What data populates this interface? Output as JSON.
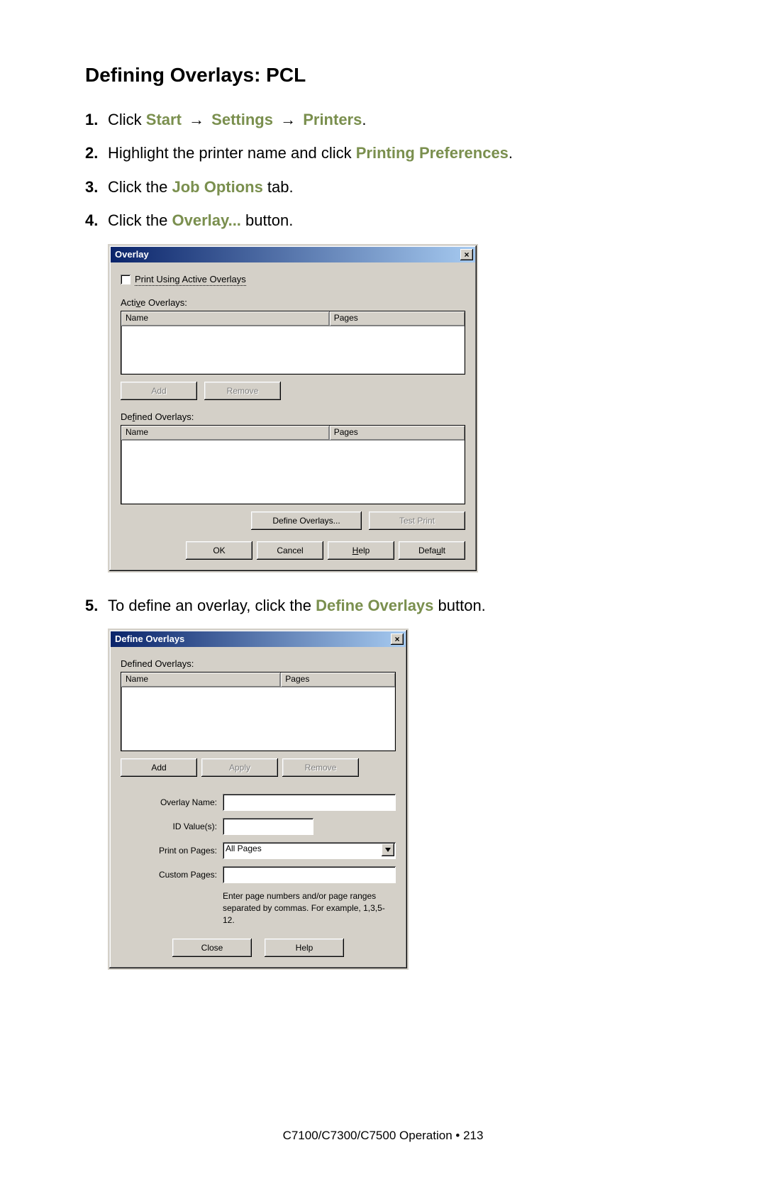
{
  "heading": "Defining Overlays: PCL",
  "steps": {
    "s1": {
      "num": "1.",
      "prefix": "Click ",
      "kw1": "Start",
      "kw2": "Settings",
      "kw3": "Printers",
      "suffix": "."
    },
    "s2": {
      "num": "2.",
      "prefix": "Highlight the printer name and click ",
      "kw": "Printing Preferences",
      "suffix": "."
    },
    "s3": {
      "num": "3.",
      "prefix": "Click the ",
      "kw": "Job Options",
      "suffix": " tab."
    },
    "s4": {
      "num": "4.",
      "prefix": "Click the ",
      "kw": "Overlay...",
      "suffix": " button."
    },
    "s5": {
      "num": "5.",
      "prefix": "To define an overlay, click the ",
      "kw": "Define Overlays",
      "suffix": " button."
    }
  },
  "dlg1": {
    "title": "Overlay",
    "close": "×",
    "print_using": "Print Using Active Overlays",
    "active_label_pre": "Acti",
    "active_label_ul": "v",
    "active_label_post": "e Overlays:",
    "col_name": "Name",
    "col_pages": "Pages",
    "btn_add": "Add",
    "btn_remove": "Remove",
    "defined_label_pre": "De",
    "defined_label_ul": "f",
    "defined_label_post": "ined Overlays:",
    "btn_define": "Define Overlays...",
    "btn_test": "Test Print",
    "btn_ok": "OK",
    "btn_cancel": "Cancel",
    "btn_help_pre": "",
    "btn_help_ul": "H",
    "btn_help_post": "elp",
    "btn_default_pre": "Defa",
    "btn_default_ul": "u",
    "btn_default_post": "lt"
  },
  "dlg2": {
    "title": "Define Overlays",
    "close": "×",
    "defined_label": "Defined Overlays:",
    "col_name": "Name",
    "col_pages": "Pages",
    "btn_add": "Add",
    "btn_apply": "Apply",
    "btn_remove": "Remove",
    "overlay_name": "Overlay Name:",
    "id_values": "ID Value(s):",
    "print_on_pages": "Print on Pages:",
    "print_on_pages_value": "All Pages",
    "custom_pages": "Custom Pages:",
    "hint": "Enter page numbers and/or page ranges separated by commas. For example, 1,3,5-12.",
    "btn_close": "Close",
    "btn_help": "Help"
  },
  "arrow": "→",
  "footer": "C7100/C7300/C7500  Operation • 213"
}
